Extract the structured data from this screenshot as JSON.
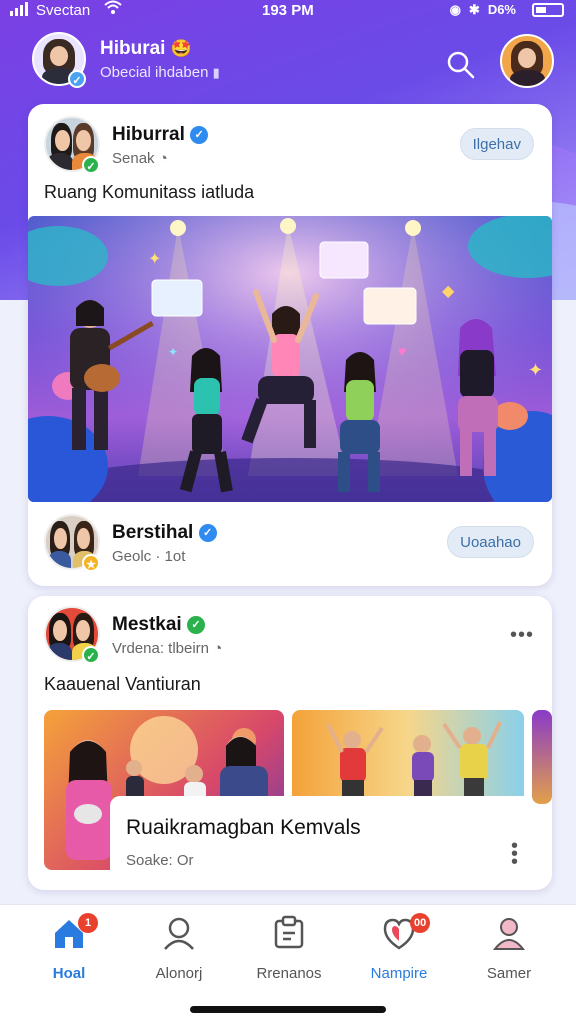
{
  "status_bar": {
    "carrier": "Svectan",
    "time": "193 PM",
    "battery": "D6%"
  },
  "header": {
    "title": "Hiburai",
    "title_emoji": "🤩",
    "subtitle": "Obecial ihdaben",
    "subtitle_icon": "mic-icon"
  },
  "posts": [
    {
      "author": "Hiburral",
      "meta": "Senak",
      "follow_label": "Ilgehav",
      "text": "Ruang Komunitass iatluda",
      "footer_author": "Berstihal",
      "footer_meta": "Geolc · 1ot",
      "footer_follow_label": "Uoaahao"
    },
    {
      "author": "Mestkai",
      "meta": "Vrdena: tlbeirn",
      "text": "Kaauenal Vantiuran",
      "caption_title": "Ruaikramagban Kemvals",
      "caption_meta": "Soake: Or"
    }
  ],
  "bottom_nav": [
    {
      "label": "Hoal",
      "icon": "home-icon",
      "badge": "1",
      "active": true
    },
    {
      "label": "Alonorj",
      "icon": "user-icon",
      "badge": "",
      "active": false
    },
    {
      "label": "Rrenanos",
      "icon": "document-icon",
      "badge": "",
      "active": false
    },
    {
      "label": "Nampire",
      "icon": "heart-shield-icon",
      "badge": "00",
      "active": false
    },
    {
      "label": "Samer",
      "icon": "profile-icon",
      "badge": "",
      "active": false
    }
  ],
  "colors": {
    "accent": "#7b3fe4",
    "nav_active": "#2a7be0",
    "verified_blue": "#2f8bf0",
    "verified_green": "#2bb24c",
    "badge_red": "#e8422f"
  }
}
